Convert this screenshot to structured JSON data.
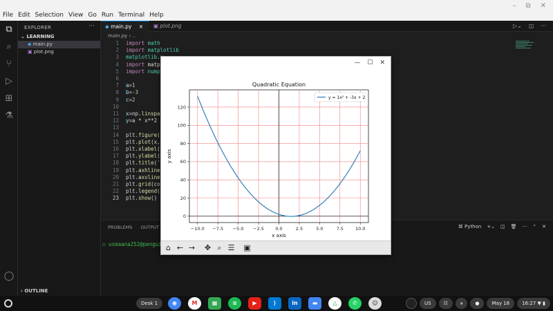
{
  "menubar": {
    "items": [
      "File",
      "Edit",
      "Selection",
      "View",
      "Go",
      "Run",
      "Terminal",
      "Help"
    ]
  },
  "sidebar": {
    "title": "EXPLORER",
    "folder": "LEARNING",
    "files": [
      "main.py",
      "plot.png"
    ],
    "outline": "OUTLINE"
  },
  "tabs": [
    {
      "label": "main.py",
      "close": "×"
    },
    {
      "label": "plot.png"
    }
  ],
  "breadcrumb": "main.py › ..",
  "editor": {
    "lines": [
      {
        "n": "1",
        "text": "import math"
      },
      {
        "n": "2",
        "text": "import matplotlib"
      },
      {
        "n": "3",
        "text": "matplotlib.u"
      },
      {
        "n": "4",
        "text": "import matpl"
      },
      {
        "n": "5",
        "text": "import numpy"
      },
      {
        "n": "6",
        "text": ""
      },
      {
        "n": "7",
        "text": "a=1"
      },
      {
        "n": "8",
        "text": "b=-3"
      },
      {
        "n": "9",
        "text": "c=2"
      },
      {
        "n": "10",
        "text": ""
      },
      {
        "n": "11",
        "text": "x=np.linspac"
      },
      {
        "n": "12",
        "text": "y=a * x**2 +"
      },
      {
        "n": "13",
        "text": ""
      },
      {
        "n": "14",
        "text": "plt.figure(f"
      },
      {
        "n": "15",
        "text": "plt.plot(x,"
      },
      {
        "n": "16",
        "text": "plt.xlabel('"
      },
      {
        "n": "17",
        "text": "plt.ylabel('"
      },
      {
        "n": "18",
        "text": "plt.title('Q"
      },
      {
        "n": "19",
        "text": "plt.axhline("
      },
      {
        "n": "20",
        "text": "plt.axvline("
      },
      {
        "n": "21",
        "text": "plt.grid(col"
      },
      {
        "n": "22",
        "text": "plt.legend()"
      },
      {
        "n": "23",
        "text": "plt.show()"
      }
    ]
  },
  "panel": {
    "tabs": [
      "PROBLEMS",
      "OUTPUT"
    ],
    "terminal_label": "Python",
    "prompt": "○ usmaana252@penguin:"
  },
  "chart_data": {
    "type": "line",
    "title": "Quadratic Equation",
    "xlabel": "x axis",
    "ylabel": "y axis",
    "legend": "y = 1x² + -3x + 2",
    "legend_position": "top-right",
    "x": [
      -10,
      -8,
      -6,
      -4,
      -2,
      0,
      1.5,
      2,
      4,
      6,
      8,
      10
    ],
    "y": [
      132,
      90,
      56,
      30,
      12,
      2,
      -0.25,
      0,
      6,
      20,
      42,
      72
    ],
    "xlim": [
      -11,
      11
    ],
    "ylim": [
      -7,
      139
    ],
    "xticks": [
      "-10.0",
      "-7.5",
      "-5.0",
      "-2.5",
      "0.0",
      "2.5",
      "5.0",
      "7.5",
      "10.0"
    ],
    "yticks": [
      "0",
      "20",
      "40",
      "60",
      "80",
      "100",
      "120"
    ],
    "grid": true,
    "grid_color": "#f08080",
    "line_color": "#1f77b4"
  },
  "shelf": {
    "desk": "Desk 1",
    "locale": "US",
    "date": "May 18",
    "time": "16:27"
  },
  "colors": {
    "accent": "#0078d4",
    "terminal_green": "#3fb950"
  }
}
